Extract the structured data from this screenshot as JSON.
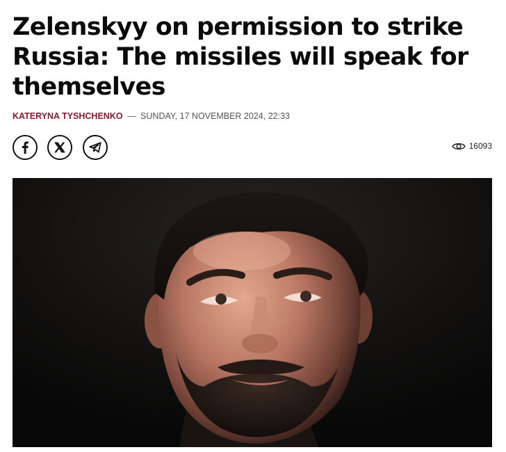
{
  "article": {
    "headline": "Zelenskyy on permission to strike Russia: The missiles will speak for themselves",
    "author": "KATERYNA TYSHCHENKO",
    "separator": "—",
    "date": "SUNDAY, 17 NOVEMBER 2024, 22:33"
  },
  "share": {
    "buttons": [
      {
        "name": "facebook",
        "icon": "facebook-icon"
      },
      {
        "name": "x",
        "icon": "x-icon"
      },
      {
        "name": "telegram",
        "icon": "telegram-icon"
      }
    ]
  },
  "stats": {
    "views_icon": "eye-icon",
    "views": "16093"
  },
  "photo": {
    "subject": "portrait-photo"
  },
  "colors": {
    "author": "#8c1a2b",
    "text": "#0b0b0b",
    "meta": "#555555"
  }
}
